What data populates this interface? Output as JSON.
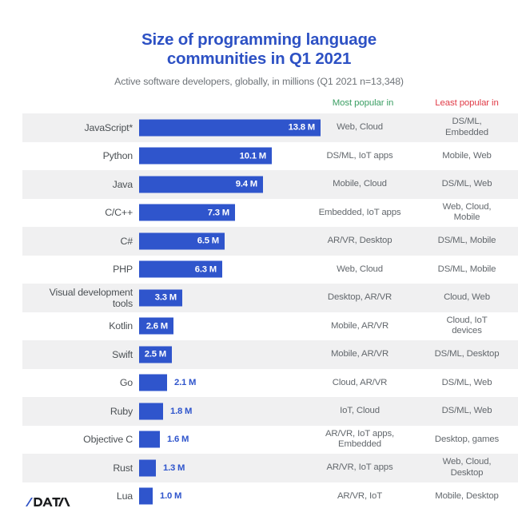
{
  "header": {
    "title_line1": "Size of programming language",
    "title_line2": "communities in Q1 2021",
    "subtitle": "Active software developers, globally, in millions (Q1 2021 n=13,348)",
    "col_most_label": "Most popular in",
    "col_least_label": "Least popular in"
  },
  "logo": {
    "text": "/DATA"
  },
  "colors": {
    "title_blue": "#2d51c4",
    "bar_blue": "#2f55cc",
    "most_green": "#3a9e63",
    "least_red": "#e03b47",
    "row_stripe": "#f0f0f1",
    "row_plain": "#ffffff",
    "label_gray": "#4c5155",
    "text_gray": "#63686d"
  },
  "chart_data": {
    "type": "bar",
    "title": "Size of programming language communities in Q1 2021",
    "subtitle": "Active software developers, globally, in millions (Q1 2021 n=13,348)",
    "xlabel": "Active software developers (millions)",
    "ylabel": "",
    "orientation": "horizontal",
    "grid": false,
    "legend": "none",
    "xlim": [
      0,
      13.8
    ],
    "unit": "M",
    "categories": [
      "JavaScript*",
      "Python",
      "Java",
      "C/C++",
      "C#",
      "PHP",
      "Visual development tools",
      "Kotlin",
      "Swift",
      "Go",
      "Ruby",
      "Objective C",
      "Rust",
      "Lua"
    ],
    "values": [
      13.8,
      10.1,
      9.4,
      7.3,
      6.5,
      6.3,
      3.3,
      2.6,
      2.5,
      2.1,
      1.8,
      1.6,
      1.3,
      1.0
    ],
    "value_labels": [
      "13.8 M",
      "10.1 M",
      "9.4 M",
      "7.3 M",
      "6.5 M",
      "6.3 M",
      "3.3 M",
      "2.6 M",
      "2.5 M",
      "2.1 M",
      "1.8 M",
      "1.6 M",
      "1.3 M",
      "1.0 M"
    ],
    "annotations": {
      "most_popular_in": [
        "Web, Cloud",
        "DS/ML, IoT apps",
        "Mobile, Cloud",
        "Embedded, IoT apps",
        "AR/VR, Desktop",
        "Web, Cloud",
        "Desktop, AR/VR",
        "Mobile, AR/VR",
        "Mobile, AR/VR",
        "Cloud, AR/VR",
        "IoT, Cloud",
        "AR/VR, IoT apps, Embedded",
        "AR/VR, IoT apps",
        "AR/VR, IoT"
      ],
      "least_popular_in": [
        "DS/ML, Embedded",
        "Mobile, Web",
        "DS/ML, Web",
        "Web, Cloud, Mobile",
        "DS/ML, Mobile",
        "DS/ML, Mobile",
        "Cloud, Web",
        "Cloud, IoT devices",
        "DS/ML, Desktop",
        "DS/ML, Web",
        "DS/ML, Web",
        "Desktop, games",
        "Web, Cloud, Desktop",
        "Mobile, Desktop"
      ]
    }
  },
  "rows": [
    {
      "label": [
        "JavaScript*"
      ],
      "value": 13.8,
      "value_label": "13.8 M",
      "most": [
        "Web, Cloud"
      ],
      "least": [
        "DS/ML,",
        "Embedded"
      ]
    },
    {
      "label": [
        "Python"
      ],
      "value": 10.1,
      "value_label": "10.1 M",
      "most": [
        "DS/ML, IoT apps"
      ],
      "least": [
        "Mobile, Web"
      ]
    },
    {
      "label": [
        "Java"
      ],
      "value": 9.4,
      "value_label": "9.4 M",
      "most": [
        "Mobile, Cloud"
      ],
      "least": [
        "DS/ML, Web"
      ]
    },
    {
      "label": [
        "C/C++"
      ],
      "value": 7.3,
      "value_label": "7.3 M",
      "most": [
        "Embedded, IoT apps"
      ],
      "least": [
        "Web, Cloud,",
        "Mobile"
      ]
    },
    {
      "label": [
        "C#"
      ],
      "value": 6.5,
      "value_label": "6.5 M",
      "most": [
        "AR/VR, Desktop"
      ],
      "least": [
        "DS/ML, Mobile"
      ]
    },
    {
      "label": [
        "PHP"
      ],
      "value": 6.3,
      "value_label": "6.3 M",
      "most": [
        "Web, Cloud"
      ],
      "least": [
        "DS/ML, Mobile"
      ]
    },
    {
      "label": [
        "Visual development",
        "tools"
      ],
      "value": 3.3,
      "value_label": "3.3 M",
      "most": [
        "Desktop, AR/VR"
      ],
      "least": [
        "Cloud, Web"
      ]
    },
    {
      "label": [
        "Kotlin"
      ],
      "value": 2.6,
      "value_label": "2.6 M",
      "most": [
        "Mobile, AR/VR"
      ],
      "least": [
        "Cloud, IoT",
        "devices"
      ]
    },
    {
      "label": [
        "Swift"
      ],
      "value": 2.5,
      "value_label": "2.5 M",
      "most": [
        "Mobile, AR/VR"
      ],
      "least": [
        "DS/ML, Desktop"
      ]
    },
    {
      "label": [
        "Go"
      ],
      "value": 2.1,
      "value_label": "2.1 M",
      "most": [
        "Cloud, AR/VR"
      ],
      "least": [
        "DS/ML, Web"
      ]
    },
    {
      "label": [
        "Ruby"
      ],
      "value": 1.8,
      "value_label": "1.8 M",
      "most": [
        "IoT, Cloud"
      ],
      "least": [
        "DS/ML, Web"
      ]
    },
    {
      "label": [
        "Objective C"
      ],
      "value": 1.6,
      "value_label": "1.6 M",
      "most": [
        "AR/VR, IoT apps,",
        "Embedded"
      ],
      "least": [
        "Desktop, games"
      ]
    },
    {
      "label": [
        "Rust"
      ],
      "value": 1.3,
      "value_label": "1.3 M",
      "most": [
        "AR/VR, IoT apps"
      ],
      "least": [
        "Web, Cloud,",
        "Desktop"
      ]
    },
    {
      "label": [
        "Lua"
      ],
      "value": 1.0,
      "value_label": "1.0 M",
      "most": [
        "AR/VR, IoT"
      ],
      "least": [
        "Mobile, Desktop"
      ]
    }
  ]
}
